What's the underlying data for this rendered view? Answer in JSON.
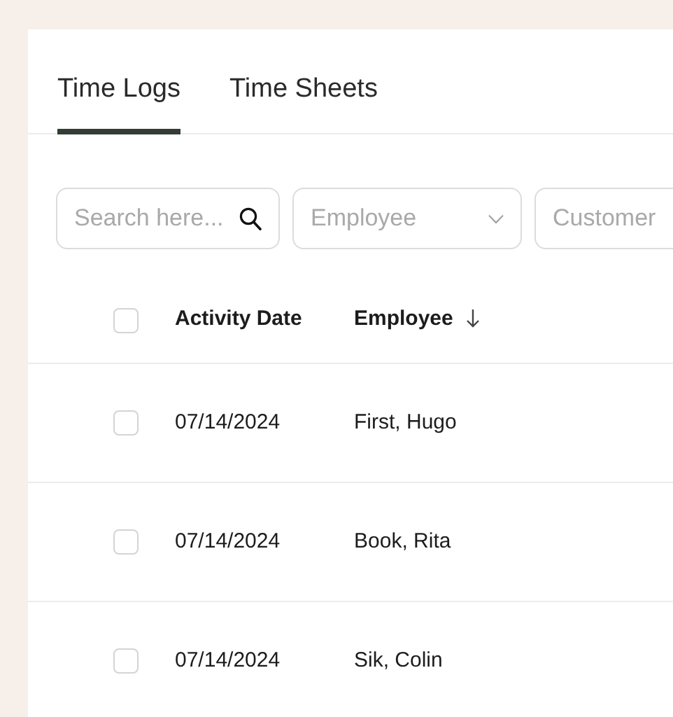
{
  "tabs": [
    {
      "label": "Time Logs",
      "selected": true
    },
    {
      "label": "Time Sheets",
      "selected": false
    }
  ],
  "filters": {
    "search": {
      "placeholder": "Search here..."
    },
    "dropdowns": [
      {
        "placeholder": "Employee",
        "chevron": true
      },
      {
        "placeholder": "Customer"
      }
    ]
  },
  "table": {
    "select_all": {
      "checked": false
    },
    "columns": [
      {
        "label": "Activity Date",
        "sorted": false
      },
      {
        "label": "Employee",
        "sorted": true
      }
    ],
    "rows": [
      {
        "checked": false,
        "cells": [
          "07/14/2024",
          "First, Hugo"
        ]
      },
      {
        "checked": false,
        "cells": [
          "07/14/2024",
          "Book, Rita"
        ]
      },
      {
        "checked": false,
        "cells": [
          "07/14/2024",
          "Sik, Colin"
        ]
      }
    ]
  }
}
